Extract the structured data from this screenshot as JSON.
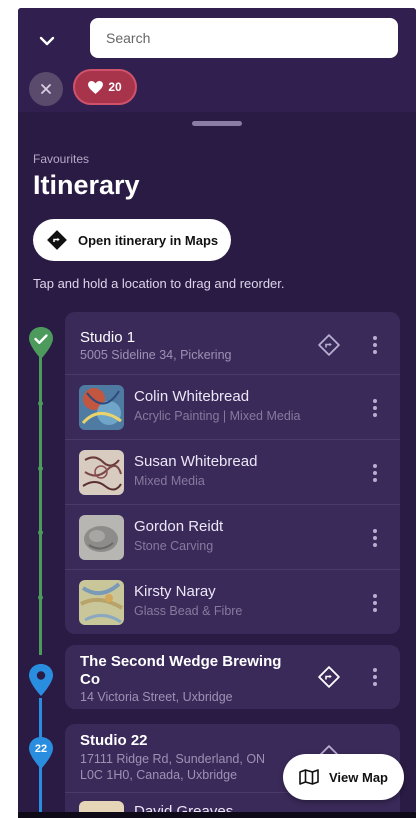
{
  "header": {
    "collapse_icon": "chevron-down-icon",
    "search": {
      "placeholder": "Search",
      "value": ""
    },
    "clear_icon": "close-icon",
    "favourites_chip": {
      "icon": "heart-icon",
      "count": "20"
    }
  },
  "sheet": {
    "eyebrow": "Favourites",
    "title": "Itinerary",
    "open_maps_label": "Open itinerary in Maps",
    "hint": "Tap and hold a location to drag and reorder."
  },
  "stops": [
    {
      "title": "Studio 1",
      "address": "5005 Sideline 34, Pickering",
      "marker": "check",
      "marker_color": "#4c9a5c",
      "artists": [
        {
          "name": "Colin Whitebread",
          "medium": "Acrylic Painting | Mixed Media"
        },
        {
          "name": "Susan Whitebread",
          "medium": "Mixed Media"
        },
        {
          "name": "Gordon Reidt",
          "medium": "Stone Carving"
        },
        {
          "name": "Kirsty Naray",
          "medium": "Glass Bead & Fibre"
        }
      ]
    },
    {
      "title": "The Second Wedge Brewing Co",
      "title_line1": "The Second Wedge Brewing",
      "title_line2": "Co",
      "address": "14 Victoria Street, Uxbridge",
      "marker": "pin",
      "marker_color": "#2a8ee0"
    },
    {
      "title": "Studio 22",
      "marker_label": "22",
      "marker_color": "#2a8ee0",
      "address_line1": "17111 Ridge Rd, Sunderland, ON",
      "address_line2": "L0C 1H0, Canada, Uxbridge",
      "artists": [
        {
          "name": "David Greaves"
        }
      ]
    }
  ],
  "view_map": {
    "icon": "map-icon",
    "label": "View Map"
  },
  "colors": {
    "background": "#2a1b44",
    "header": "#31204f",
    "card": "#3a2a5a",
    "favourite_accent": "#a8344c",
    "timeline_green": "#4c9a5c",
    "timeline_blue": "#2a8ee0"
  }
}
